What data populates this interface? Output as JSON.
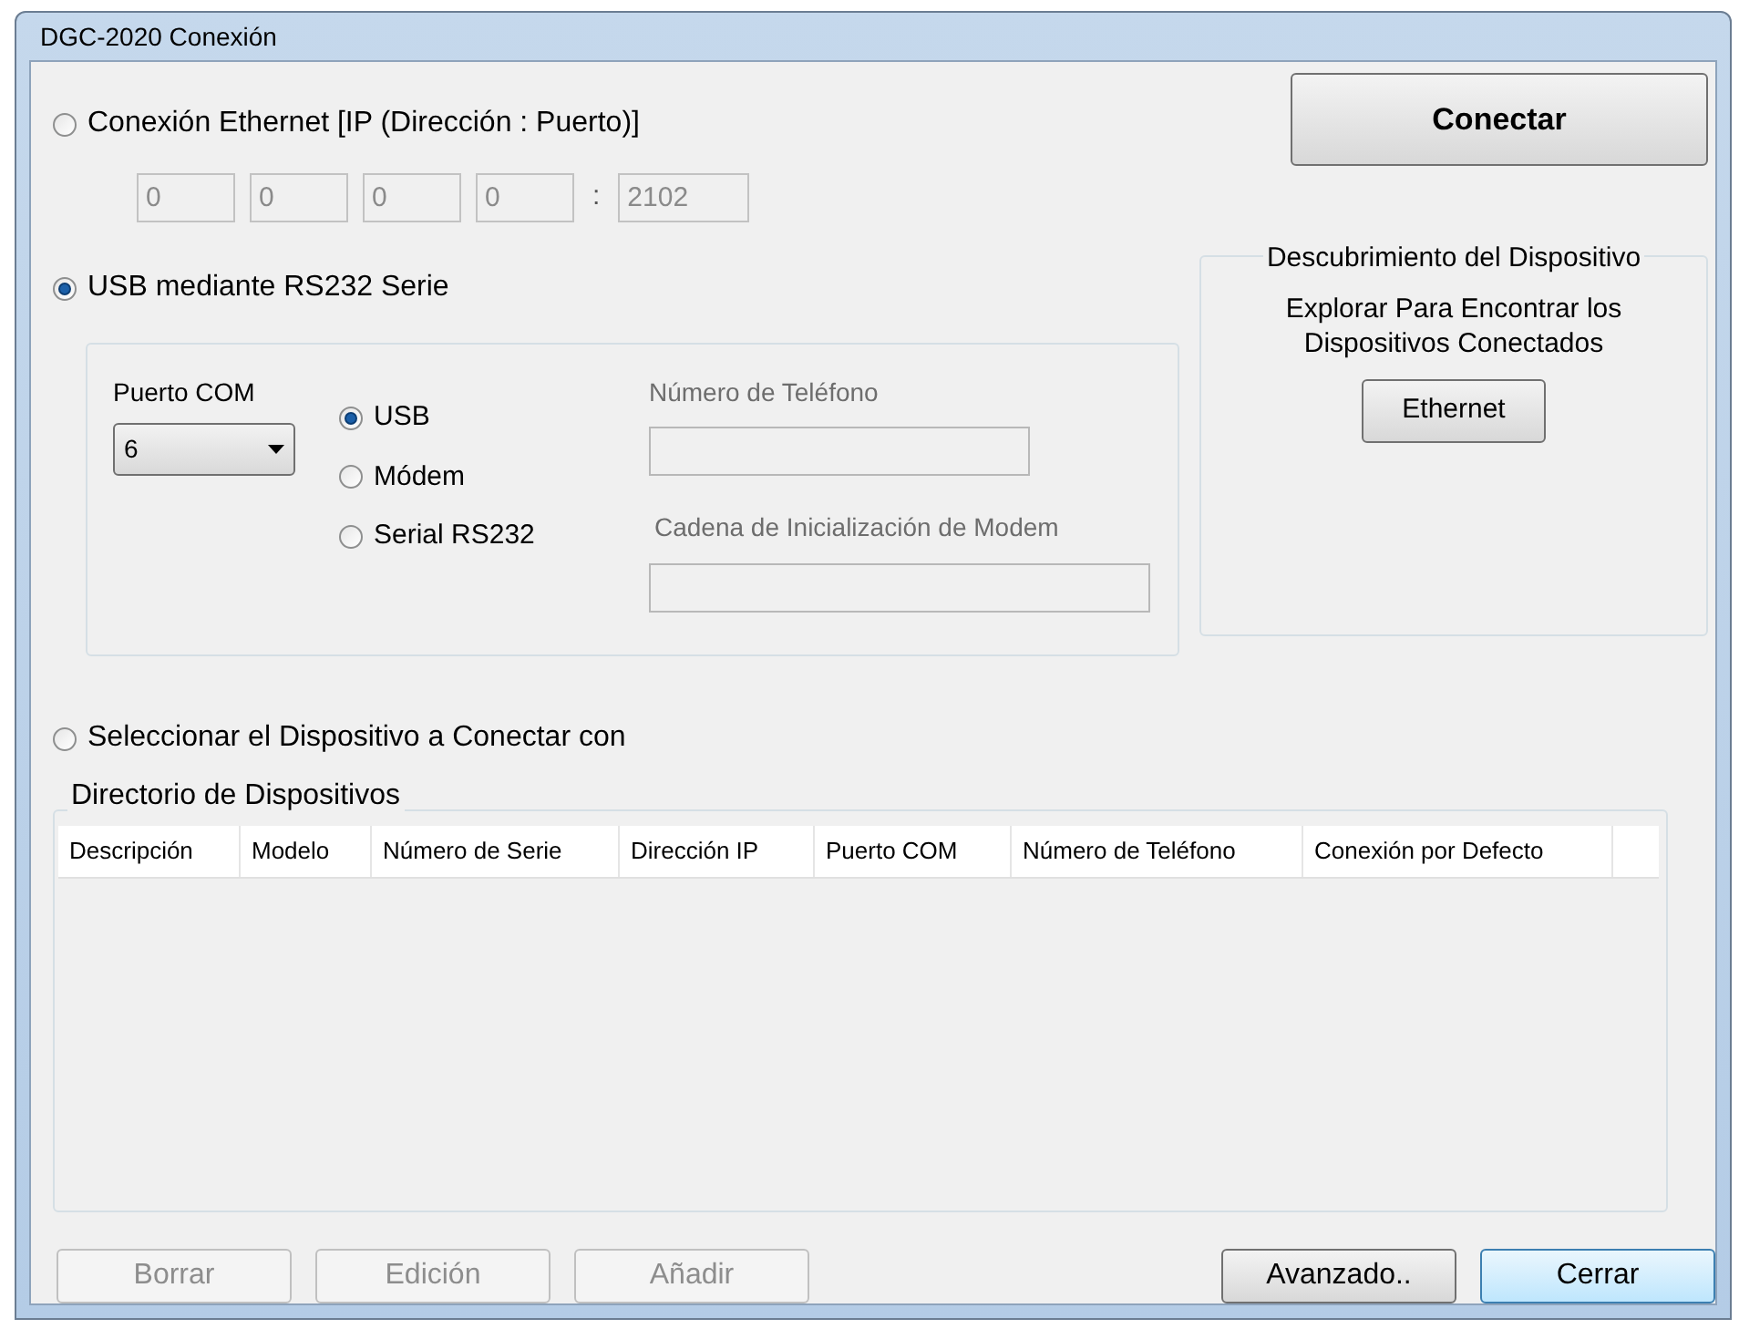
{
  "window": {
    "title": "DGC-2020 Conexión"
  },
  "ethernet": {
    "label": "Conexión Ethernet [IP (Dirección : Puerto)]",
    "selected": false,
    "disabled": true,
    "ip_fields": [
      "0",
      "0",
      "0",
      "0"
    ],
    "separator": ":",
    "port": "2102"
  },
  "usb": {
    "label": "USB mediante RS232 Serie",
    "selected": true,
    "com_port": {
      "label": "Puerto COM",
      "value": "6"
    },
    "modes": [
      {
        "label": "USB",
        "selected": true
      },
      {
        "label": "Módem",
        "selected": false
      },
      {
        "label": "Serial RS232",
        "selected": false
      }
    ],
    "phone": {
      "label": "Número de Teléfono",
      "disabled": true
    },
    "init_string": {
      "label": "Cadena de Inicialización de Modem",
      "disabled": true
    }
  },
  "select_device": {
    "label": "Seleccionar el Dispositivo a Conectar con",
    "selected": false
  },
  "connect_button": {
    "label": "Conectar"
  },
  "discovery": {
    "title": "Descubrimiento del Dispositivo",
    "description": "Explorar Para Encontrar los Dispositivos Conectados",
    "button": "Ethernet"
  },
  "directory": {
    "title": "Directorio de Dispositivos",
    "columns": [
      "Descripción",
      "Modelo",
      "Número de Serie",
      "Dirección IP",
      "Puerto COM",
      "Número de Teléfono",
      "Conexión por Defecto"
    ]
  },
  "buttons": [
    {
      "label": "Borrar",
      "disabled": true,
      "focused": false
    },
    {
      "label": "Edición",
      "disabled": true,
      "focused": false
    },
    {
      "label": "Añadir",
      "disabled": true,
      "focused": false
    },
    {
      "label": "Avanzado..",
      "disabled": false,
      "focused": false
    },
    {
      "label": "Cerrar",
      "disabled": false,
      "focused": true
    }
  ]
}
